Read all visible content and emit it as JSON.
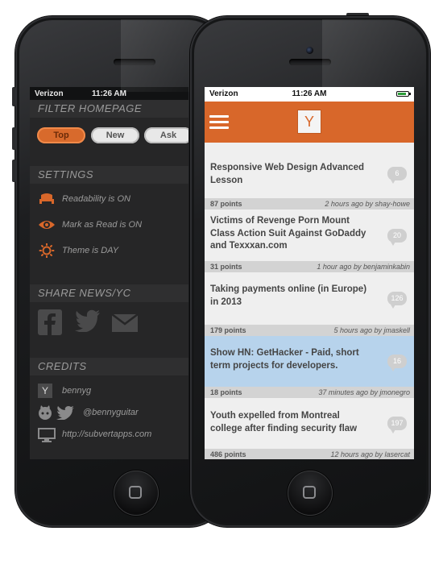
{
  "status_back": {
    "carrier": "Verizon",
    "time": "11:26 AM"
  },
  "status_front": {
    "carrier": "Verizon",
    "time": "11:26 AM"
  },
  "menu": {
    "filter_title": "FILTER HOMEPAGE",
    "filters": [
      {
        "label": "Top",
        "active": true
      },
      {
        "label": "New",
        "active": false
      },
      {
        "label": "Ask",
        "active": false
      }
    ],
    "settings_title": "SETTINGS",
    "settings": [
      {
        "icon": "chair-icon",
        "label": "Readability is ON"
      },
      {
        "icon": "eye-icon",
        "label": "Mark as Read is ON"
      },
      {
        "icon": "sun-icon",
        "label": "Theme is DAY"
      }
    ],
    "share_title": "SHARE NEWS/YC",
    "share_icons": [
      "facebook-icon",
      "twitter-icon",
      "mail-icon"
    ],
    "credits_title": "CREDITS",
    "credits": [
      {
        "icon": "y-logo-icon",
        "label": "bennyg"
      },
      {
        "icon": "github-twitter-icon",
        "label": "@bennyguitar"
      },
      {
        "icon": "monitor-icon",
        "label": "http://subvertapps.com"
      }
    ]
  },
  "navbar": {
    "logo_letter": "Y"
  },
  "stories": [
    {
      "title": "Responsive Web Design Advanced Lesson",
      "comments": "6",
      "points": "87 points",
      "meta": "2 hours ago by shay-howe",
      "highlight": false
    },
    {
      "title": "Victims of Revenge Porn Mount Class Action Suit Against GoDaddy and Texxxan.com",
      "comments": "20",
      "points": "31 points",
      "meta": "1 hour ago by benjaminkabin",
      "highlight": false
    },
    {
      "title": "Taking payments online (in Europe) in 2013",
      "comments": "126",
      "points": "179 points",
      "meta": "5 hours ago by jmaskell",
      "highlight": false
    },
    {
      "title": "Show HN: GetHacker - Paid, short term projects for developers.",
      "comments": "16",
      "points": "18 points",
      "meta": "37 minutes ago by jmonegro",
      "highlight": true
    },
    {
      "title": "Youth expelled from Montreal college after finding security flaw",
      "comments": "197",
      "points": "486 points",
      "meta": "12 hours ago by lasercat",
      "highlight": false
    }
  ],
  "colors": {
    "accent": "#d8672a",
    "highlight_row": "#b7d3ec",
    "menu_bg": "#262627"
  }
}
